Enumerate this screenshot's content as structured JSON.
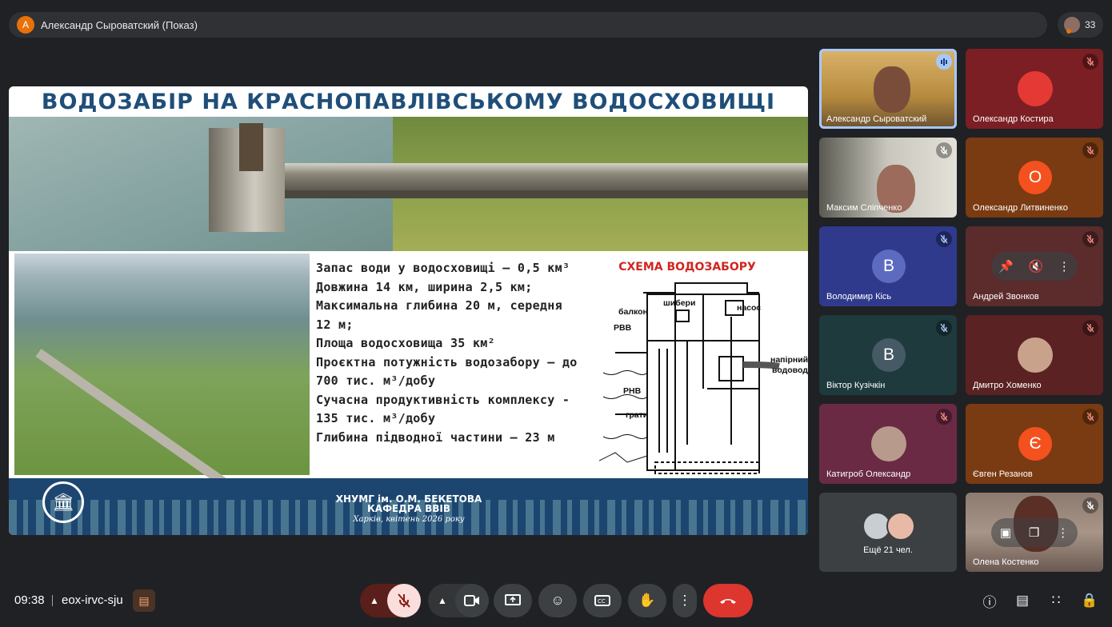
{
  "presenter": {
    "initial": "А",
    "title": "Александр Сыроватский (Показ)"
  },
  "participants_count": "33",
  "slide": {
    "title": "ВОДОЗАБІР НА КРАСНОПАВЛІВСЬКОМУ ВОДОСХОВИЩІ",
    "facts": [
      "Запас води у водосховищі – 0,5 км³",
      "Довжина 14 км, ширина 2,5 км;",
      "Максимальна глибина 20 м, середня",
      "12 м;",
      "Площа водосховища 35 км²",
      "Проєктна потужність водозабору – до",
      "700 тис. м³/добу",
      "Сучасна продуктивність комплексу -",
      "135 тис. м³/добу",
      "Глибина підводної частини – 23 м"
    ],
    "scheme_title": "СХЕМА ВОДОЗАБОРУ",
    "scheme_labels": {
      "balcony": "балкон",
      "gates": "шибери",
      "pump": "насос",
      "rvv": "РВВ",
      "rnv": "РНВ",
      "grates": "грати",
      "pressure_line1": "напірний",
      "pressure_line2": "водовод"
    },
    "footer": {
      "line1": "ХНУМГ ім. О.М. БЕКЕТОВА",
      "line2": "КАФЕДРА ВВІВ",
      "line3": "Харків, квітень 2026 року"
    }
  },
  "tiles": [
    {
      "name": "Александр Сыроватский",
      "kind": "video",
      "active": true
    },
    {
      "name": "Олександр Костира",
      "kind": "photo",
      "bg": "#7b1f24"
    },
    {
      "name": "Максим Сліпченко",
      "kind": "video"
    },
    {
      "name": "Олександр Литвиненко",
      "kind": "letter",
      "letter": "О",
      "bg": "#7a3b12",
      "circle": "#f4511e"
    },
    {
      "name": "Володимир Кісь",
      "kind": "letter",
      "letter": "В",
      "bg": "#2f3a8c",
      "circle": "#5c6bc0"
    },
    {
      "name": "Андрей Звонков",
      "kind": "hover",
      "bg": "#5c2b2b"
    },
    {
      "name": "Віктор Кузічкін",
      "kind": "letter",
      "letter": "В",
      "bg": "#1e3a3d",
      "circle": "#455a64"
    },
    {
      "name": "Дмитро Хоменко",
      "kind": "photo",
      "bg": "#5a2222"
    },
    {
      "name": "Катигроб Олександр",
      "kind": "photo",
      "bg": "#6a2a43"
    },
    {
      "name": "Євген Резанов",
      "kind": "letter",
      "letter": "Є",
      "bg": "#7a3b12",
      "circle": "#f4511e"
    },
    {
      "name": "Олена Костенко",
      "kind": "video"
    }
  ],
  "more_label": "Ещё 21 чел.",
  "bottom": {
    "time": "09:38",
    "meeting_code": "eox-irvc-sju"
  },
  "icons": {
    "mic_off": "mic-off-icon",
    "camera": "camera-icon",
    "present": "present-screen-icon",
    "emoji": "emoji-icon",
    "captions": "captions-icon",
    "hand": "raise-hand-icon",
    "more": "more-options-icon",
    "end": "end-call-icon",
    "info": "info-icon",
    "chat": "chat-icon",
    "activities": "activities-icon",
    "host": "host-controls-icon"
  }
}
